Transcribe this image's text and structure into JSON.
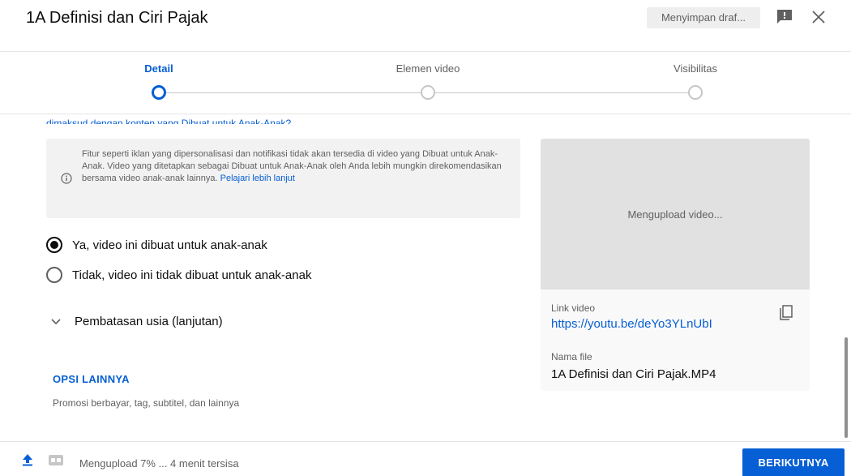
{
  "header": {
    "title": "1A Definisi dan Ciri Pajak",
    "saving_status": "Menyimpan draf..."
  },
  "stepper": {
    "steps": [
      {
        "label": "Detail",
        "state": "active"
      },
      {
        "label": "Elemen video",
        "state": "inactive"
      },
      {
        "label": "Visibilitas",
        "state": "inactive"
      }
    ]
  },
  "audience": {
    "cut_link_text": "dimaksud dengan konten yang Dibuat untuk Anak-Anak?",
    "info_text": "Fitur seperti iklan yang dipersonalisasi dan notifikasi tidak akan tersedia di video yang Dibuat untuk Anak-Anak. Video yang ditetapkan sebagai Dibuat untuk Anak-Anak oleh Anda lebih mungkin direkomendasikan bersama video anak-anak lainnya.",
    "info_link": "Pelajari lebih lanjut",
    "options": [
      {
        "label": "Ya, video ini dibuat untuk anak-anak",
        "checked": true
      },
      {
        "label": "Tidak, video ini tidak dibuat untuk anak-anak",
        "checked": false
      }
    ],
    "age_restriction_label": "Pembatasan usia (lanjutan)"
  },
  "more_options": {
    "title": "OPSI LAINNYA",
    "subtitle": "Promosi berbayar, tag, subtitel, dan lainnya"
  },
  "video_card": {
    "preview_status": "Mengupload video...",
    "link_caption": "Link video",
    "link_value": "https://youtu.be/deYo3YLnUbI",
    "file_caption": "Nama file",
    "file_value": "1A Definisi dan Ciri Pajak.MP4"
  },
  "footer": {
    "upload_status": "Mengupload 7% ... 4 menit tersisa",
    "next_label": "BERIKUTNYA"
  },
  "colors": {
    "accent": "#065fd4",
    "muted_text": "#606060",
    "info_bg": "#f2f2f2",
    "preview_bg": "#e1e1e1"
  }
}
